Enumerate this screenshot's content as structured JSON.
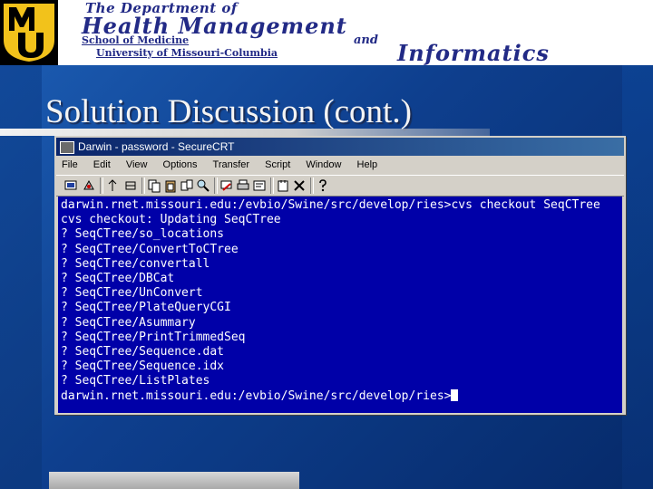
{
  "banner": {
    "logo_letters": "MU",
    "line1": "The Department of",
    "line2": "Health Management",
    "line3": "School of Medicine",
    "line4": "and",
    "line5": "University of Missouri-Columbia",
    "line6": "Informatics"
  },
  "slide": {
    "title": "Solution Discussion (cont.)"
  },
  "window": {
    "title": "Darwin - password - SecureCRT",
    "menu": [
      "File",
      "Edit",
      "View",
      "Options",
      "Transfer",
      "Script",
      "Window",
      "Help"
    ],
    "terminal_lines": [
      "darwin.rnet.missouri.edu:/evbio/Swine/src/develop/ries>cvs checkout SeqCTree",
      "cvs checkout: Updating SeqCTree",
      "? SeqCTree/so_locations",
      "? SeqCTree/ConvertToCTree",
      "? SeqCTree/convertall",
      "? SeqCTree/DBCat",
      "? SeqCTree/UnConvert",
      "? SeqCTree/PlateQueryCGI",
      "? SeqCTree/Asummary",
      "? SeqCTree/PrintTrimmedSeq",
      "? SeqCTree/Sequence.dat",
      "? SeqCTree/Sequence.idx",
      "? SeqCTree/ListPlates",
      "darwin.rnet.missouri.edu:/evbio/Swine/src/develop/ries>"
    ]
  },
  "colors": {
    "terminal_bg": "#0000a8",
    "titlebar": "#0a246a",
    "banner_text": "#222a86",
    "logo_gold": "#f2c21b"
  },
  "icons": {
    "toolbar": [
      "connect-icon",
      "quick-connect-icon",
      "connect-tab-icon",
      "disconnect-icon",
      "copy-icon",
      "paste-icon",
      "copy-paste-icon",
      "find-icon",
      "print-icon",
      "print-screen-icon",
      "properties-icon",
      "settings-icon",
      "sftp-icon",
      "help-icon"
    ]
  }
}
